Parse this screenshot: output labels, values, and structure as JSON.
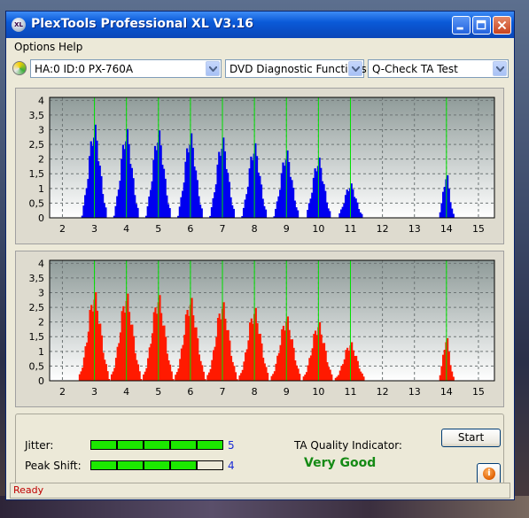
{
  "window": {
    "title": "PlexTools Professional XL V3.16",
    "app_icon_text": "XL"
  },
  "menu": [
    "Options",
    "Help"
  ],
  "toolbar": {
    "drive": "HA:0 ID:0  PX-760A",
    "function": "DVD Diagnostic Functions",
    "test": "Q-Check TA Test"
  },
  "colors": {
    "top_bars": "#0000f0",
    "bottom_bars": "#ff1a00",
    "marker_lines": "#00e000",
    "quality_text": "#158a15",
    "status_text": "#c00000"
  },
  "chart_data": [
    {
      "type": "bar",
      "series": [
        {
          "name": "",
          "color": "#0000f0"
        }
      ],
      "x_tick_labels": [
        "2",
        "3",
        "4",
        "5",
        "6",
        "7",
        "8",
        "9",
        "10",
        "11",
        "12",
        "13",
        "14",
        "15"
      ],
      "y_tick_labels": [
        "0",
        "0,5",
        "1",
        "1,5",
        "2",
        "2,5",
        "3",
        "3,5",
        "4"
      ],
      "xlim": [
        1.6,
        15.5
      ],
      "ylim": [
        0,
        4.1
      ],
      "marker_x": [
        3,
        4,
        5,
        6,
        7,
        8,
        9,
        10,
        11,
        14
      ],
      "peaks": [
        {
          "x": 3,
          "value": 3.25
        },
        {
          "x": 4,
          "value": 3.1
        },
        {
          "x": 5,
          "value": 3.05
        },
        {
          "x": 6,
          "value": 2.95
        },
        {
          "x": 7,
          "value": 2.8
        },
        {
          "x": 8,
          "value": 2.6
        },
        {
          "x": 9,
          "value": 2.35
        },
        {
          "x": 10,
          "value": 2.1
        },
        {
          "x": 11,
          "value": 1.2
        },
        {
          "x": 14,
          "value": 1.55
        }
      ],
      "grid": true
    },
    {
      "type": "bar",
      "series": [
        {
          "name": "",
          "color": "#ff1a00"
        }
      ],
      "x_tick_labels": [
        "2",
        "3",
        "4",
        "5",
        "6",
        "7",
        "8",
        "9",
        "10",
        "11",
        "12",
        "13",
        "14",
        "15"
      ],
      "y_tick_labels": [
        "0",
        "0,5",
        "1",
        "1,5",
        "2",
        "2,5",
        "3",
        "3,5",
        "4"
      ],
      "xlim": [
        1.6,
        15.5
      ],
      "ylim": [
        0,
        4.1
      ],
      "marker_x": [
        3,
        4,
        5,
        6,
        7,
        8,
        9,
        10,
        11,
        14
      ],
      "peaks": [
        {
          "x": 3,
          "value": 3.1
        },
        {
          "x": 4,
          "value": 3.05
        },
        {
          "x": 5,
          "value": 3.0
        },
        {
          "x": 6,
          "value": 2.9
        },
        {
          "x": 7,
          "value": 2.75
        },
        {
          "x": 8,
          "value": 2.55
        },
        {
          "x": 9,
          "value": 2.25
        },
        {
          "x": 10,
          "value": 2.05
        },
        {
          "x": 11,
          "value": 1.35
        },
        {
          "x": 14,
          "value": 1.55
        }
      ],
      "grid": true
    }
  ],
  "metrics": {
    "jitter_label": "Jitter:",
    "jitter_value": "5",
    "jitter_level": 5,
    "peak_shift_label": "Peak Shift:",
    "peak_shift_value": "4",
    "peak_shift_level": 4,
    "segments_total": 5
  },
  "quality": {
    "label": "TA Quality Indicator:",
    "value": "Very Good"
  },
  "buttons": {
    "start": "Start",
    "info_icon": "info-icon"
  },
  "status": {
    "text": "Ready"
  }
}
